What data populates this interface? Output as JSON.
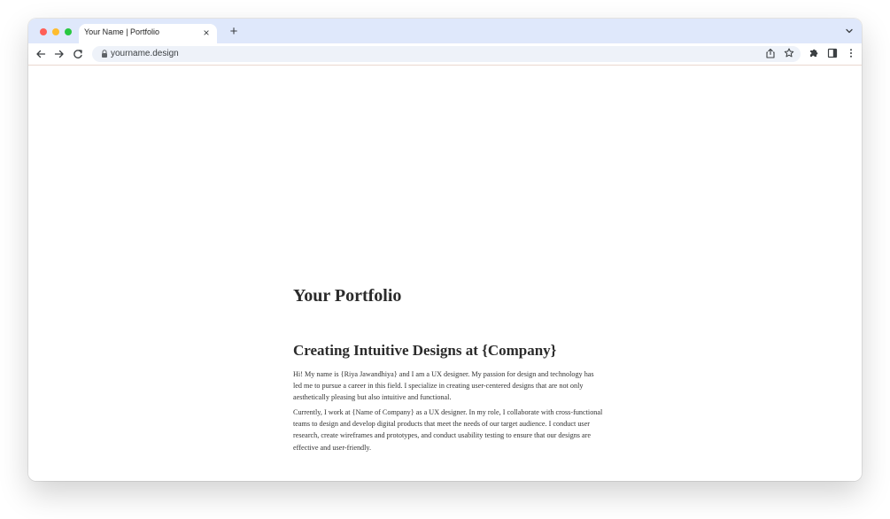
{
  "browser": {
    "tab": {
      "title": "Your Name | Portfolio",
      "close_icon": "close-icon"
    },
    "new_tab_label": "+",
    "address": {
      "url": "yourname.design",
      "lock_icon": "lock-icon"
    },
    "icons": {
      "back": "arrow-left-icon",
      "forward": "arrow-right-icon",
      "reload": "reload-icon",
      "share": "share-icon",
      "bookmark": "star-icon",
      "extensions": "puzzle-icon",
      "side_panel": "side-panel-icon",
      "menu": "kebab-menu-icon",
      "tab_menu": "chevron-down-icon"
    },
    "colors": {
      "titlebar": "#dfe8fb",
      "omnibox": "#eef2f9",
      "close": "#ff5f57",
      "minimize": "#febc2e",
      "maximize": "#28c840"
    }
  },
  "page": {
    "title": "Your Portfolio",
    "section": {
      "heading": "Creating Intuitive Designs at {Company}",
      "paragraphs": [
        "Hi! My name is {Riya Jawandhiya} and I am a UX designer. My passion for design and technology has led me to pursue a career in this field. I specialize in creating user-centered designs that are not only aesthetically pleasing but also intuitive and functional.",
        "Currently, I work at {Name of Company} as a UX designer. In my role, I collaborate with cross-functional teams to design and develop digital products that meet the needs of our target audience. I conduct user research, create wireframes and prototypes, and conduct usability testing to ensure that our designs are effective and user-friendly."
      ]
    }
  }
}
